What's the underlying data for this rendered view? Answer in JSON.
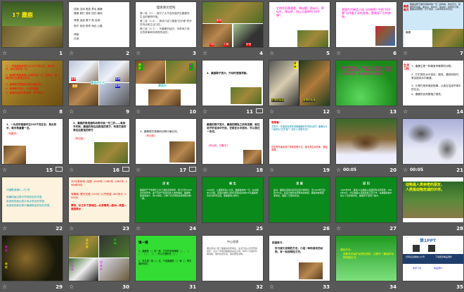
{
  "slides": [
    {
      "n": "1",
      "star": true,
      "texts": [
        "17 麋鹿"
      ]
    },
    {
      "n": "2",
      "star": true,
      "texts": [
        "·湿润  沼泽  栖息  茸毛  麋鹿",
        "·麋鹿  繁衍  濒危  回归  腹地",
        "·摩擦  追逐  蹄子  角  坐骑",
        "·刚才  依然  悲惨  海边  公路",
        "·神秘",
        "·灭绝"
      ]
    },
    {
      "n": "3",
      "star": true,
      "texts": [
        "理清课文结构",
        "第一段（1）：描写了大丰自然保护区麋鹿所生活的美丽环境。",
        "第二段（2-4）：具体介绍了麋鹿\"四不像\"的外形特点和生活习性。",
        "第三段（5-7）：写麋鹿的经历、传奇而又悲壮的故事和传奇般的经历。"
      ]
    },
    {
      "n": "4",
      "star": true,
      "texts": [
        "鹿角",
        "马脸",
        "牛蹄",
        "驴尾"
      ]
    },
    {
      "n": "5",
      "star": true,
      "texts": [
        "它的外形像骆驼，角似鹿，面似马，蹄似牛，尾似驴，所以又被称作\"四不像\"。"
      ]
    },
    {
      "n": "6",
      "star": true,
      "texts": [
        "我国古代神话小说《封神榜》中把\"四不像\"当作姜子牙的坐骑，更增添了它的神秘。"
      ]
    },
    {
      "n": "7",
      "star": true,
      "texts": [
        "麋鹿概况",
        "麋鹿是属于鹿科动物中独一无二的种类，体态高大，其角形状似鹿，面似马，蹄似牛，尾似驴，俗称四不像。麋鹿喜欢群居，善于游泳，以青草和水草为食。",
        "麋鹿"
      ]
    },
    {
      "n": "8",
      "star": true,
      "texts": [
        "1、一般雄麋鹿体型可达250千克左右，角尖较长，每对角重量一左。",
        "2、麋鹿的角是麋鹿以动物中独一无二的特征，麋鹿的角往后脱落后长出。",
        "3、麋鹿尾巴是鹿科动物中最长的。",
        "4、麋鹿蹄子宽大，行动时便捷。",
        "5、麋鹿的毛色冬夏有别，季节变化。"
      ]
    },
    {
      "n": "9",
      "star": true,
      "texts": [
        "麋鹿",
        "麋鹿",
        "麋鹿的生活",
        "麋鹿",
        "麋鹿"
      ]
    },
    {
      "n": "10",
      "star": true,
      "texts": [
        "鹿角",
        "鹿角",
        "麋鹿的"
      ]
    },
    {
      "n": "11",
      "star": true,
      "anim": true,
      "texts": [
        "4、麋鹿蹄子宽大，行动时便捷灵敏。"
      ]
    },
    {
      "n": "12",
      "star": true,
      "texts": [
        "冬季的毛色",
        "夏季的毛色",
        "麋鹿"
      ]
    },
    {
      "n": "13",
      "star": true,
      "texts": [
        "麋鹿的蹄子宽大，能在泥泞中行走自如，擅长游泳。麋鹿喜欢群居，以青草和水草为食，在沼泽地带繁衍生息，是我国特有的珍稀动物。"
      ]
    },
    {
      "n": "14",
      "star": true,
      "texts": [
        "生活习性",
        "1、麋鹿生是一种喜食禾嫩草的动物。",
        "2、它们常在水中游泳、嬉戏，遇到危险时，常会逃到水中躲避。",
        "3、长尾巴用来驱赶蚊蝇，以适应沼泽环境中的生活。",
        "4、麋鹿的自然繁殖力很低。"
      ]
    },
    {
      "n": "15",
      "star": true,
      "anim": true,
      "texts": [
        "1、一头成年雄鹿可达250千克左右，角尖较长，每对角重量一左。",
        "（列数字）"
      ]
    },
    {
      "n": "16",
      "star": true,
      "anim": true,
      "texts": [
        "2、麋鹿的角是鹿科动物中独一无二的——每到冬时候，麋鹿的角往后脱落的原方，有其它鹿的角往后脱落的原方",
        "（作比较）"
      ]
    },
    {
      "n": "17",
      "star": true,
      "anim": true,
      "texts": [
        "3、麋鹿尾巴是鹿科动物中最长的。",
        "（作比较）"
      ]
    },
    {
      "n": "18",
      "star": true,
      "texts": [
        "麋鹿的蹄子宽大，麋鹿的脚趾之间有皮腱，能在泥泞的沼泽中行走，还能在水中游泳，可以游过一条河。",
        "（作比较，列数字）"
      ]
    },
    {
      "n": "19",
      "star": true,
      "texts": [
        "想想看：",
        "文章中，作者是怎样来说明麋鹿的外形特点的？麋鹿为什么被称为\"四不像\"？用什么说明方法？",
        "在这里作者用到了多种说明方法，使文章生动形象，通俗易懂。"
      ]
    },
    {
      "n": "20",
      "star": true,
      "timing": "00:05",
      "texts": []
    },
    {
      "n": "21",
      "star": true,
      "timing": "00:05",
      "texts": []
    },
    {
      "n": "22",
      "star": true,
      "texts": [
        "仔细默读第5—7小节",
        "用横线画出表示时间变化的词语。",
        "用波浪线画出表示地点变化的词语。",
        "用波浪线画出表示麋鹿数量变化的词语。"
      ]
    },
    {
      "n": "23",
      "star": true,
      "texts": [
        "3000多年前  -战国  -1900年  -1985年  -1987年  -1986年8月",
        "有麋鹿  -野外灭绝  -120头  -几乎绝迹  -400多头  -2000头",
        "黄河、长江中下游地区—北京南苑—欧洲—英国—返回故乡"
      ]
    },
    {
      "n": "24",
      "star": true,
      "texts": [
        "历  史",
        "麋鹿原产于我国长江中下游的沼泽地带，距今已有3000多年的历史。由于自然气候变化和人类的捕杀，麋鹿数量逐渐减少，到19世纪，只剩下北京南苑皇家猎苑内的一群。"
      ]
    },
    {
      "n": "25",
      "star": false,
      "texts": [
        "新  生",
        "1900年，八国联军攻入北京，麋鹿被掠夺一空，在中国本土灭绝。英国贝福特公爵将流落在欧洲的18头麋鹿收养在乌邦寺庄园，使麋鹿得以繁衍。"
      ]
    },
    {
      "n": "26",
      "star": false,
      "texts": [
        "发  展",
        "此后，麋鹿在英国乌邦寺庄园不断繁衍，至1983年已达到255头，后来分散到世界各地动物园，麋鹿的数量逐渐增加，摆脱了灭绝的厄运。"
      ]
    },
    {
      "n": "27",
      "star": true,
      "texts": [
        "回  归",
        "1985年8月，首批22头麋鹿从英国回到北京南苑，1986年8月，39头麋鹿从英国运抵江苏大丰，在麋鹿的故乡建立了自然保护区，麋鹿终于回到了故乡。"
      ]
    },
    {
      "n": "28",
      "star": false,
      "texts": [
        "动物是人类亲密的朋友，",
        "人类是动物忠诚的伙伴。"
      ]
    },
    {
      "n": "29",
      "star": true,
      "texts": [
        "懒猴",
        "懒猴"
      ]
    },
    {
      "n": "30",
      "star": true,
      "texts": [
        "金丝猴",
        "朱鹮",
        "大熊猫",
        "扭角羚"
      ]
    },
    {
      "n": "31",
      "star": false,
      "texts": [
        "填一填",
        "1、麋鹿是（ ）的一种，它的外形像骆驼（ ）、（ ）、（ ）、（ ），所以又被称作（ ）。",
        "2、本文是一篇（ ）文，介绍麋鹿的（ ）和（ ）等方面的知识。"
      ]
    },
    {
      "n": "32",
      "star": false,
      "texts": [
        "中心思想",
        "课文通过介绍了麋鹿的外形特点、生活习性以及传奇的经历，表达了作者对麋鹿的喜爱之情，呼吁人们保护珍稀动物，保护自然环境，保护野生动物。"
      ]
    },
    {
      "n": "33",
      "star": true,
      "texts": [
        "拓展练习：",
        "学习课文说明的方法，介绍一种你喜欢的动物，写一段说明性文字。"
      ]
    },
    {
      "n": "34",
      "star": false,
      "texts": [
        "课后作业：",
        "搜集有关保护动物的资料，试着写一篇保护动物的倡议书。"
      ]
    },
    {
      "n": "35",
      "star": false,
      "texts": [
        "第1PPT",
        "扫码关注微信公众号",
        "下载更多精品课件",
        "免费下载",
        "精品课件"
      ]
    }
  ],
  "colors": {
    "bg": "#585858",
    "green": "#0a8a1a",
    "red": "#ff0000",
    "magenta": "#ff00cc"
  }
}
